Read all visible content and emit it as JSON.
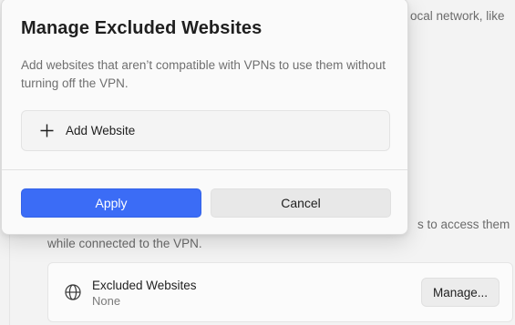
{
  "background": {
    "line_1": "ocal network, like",
    "line_2": "s to access them",
    "line_3": "while connected to the VPN.",
    "card": {
      "title": "Excluded Websites",
      "subtitle": "None",
      "button_label": "Manage...",
      "icon": "globe-icon"
    }
  },
  "dialog": {
    "title": "Manage Excluded Websites",
    "description": "Add websites that aren’t compatible with VPNs to use them without turning off the VPN.",
    "add_label": "Add Website",
    "add_icon": "plus-icon",
    "apply_label": "Apply",
    "cancel_label": "Cancel"
  },
  "colors": {
    "accent": "#3b6cf6",
    "background": "#f3f3f3",
    "dialog": "#fafafa"
  }
}
